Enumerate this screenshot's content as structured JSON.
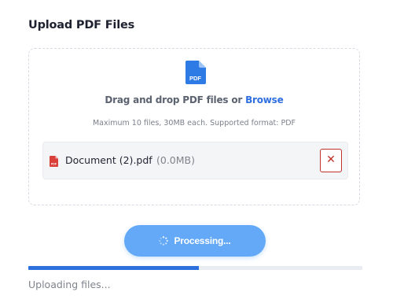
{
  "header": {
    "title": "Upload PDF Files"
  },
  "dropzone": {
    "icon": "pdf-file-icon",
    "drag_text": "Drag and drop PDF files or",
    "browse_label": "Browse",
    "hint": "Maximum 10 files, 30MB each. Supported format: PDF"
  },
  "files": [
    {
      "icon": "pdf-file-icon",
      "name": "Document (2).pdf",
      "size": "(0.0MB)",
      "remove_label": "✕"
    }
  ],
  "actions": {
    "processing_label": "Processing..."
  },
  "progress": {
    "fraction": 0.51,
    "status": "Uploading files..."
  },
  "colors": {
    "accent": "#2f6fe0",
    "button": "#63a9f7",
    "progress": "#2d6fdc",
    "danger": "#c0312b",
    "pdf_icon_big": "#2f7be6",
    "pdf_icon_small": "#d9403a"
  }
}
